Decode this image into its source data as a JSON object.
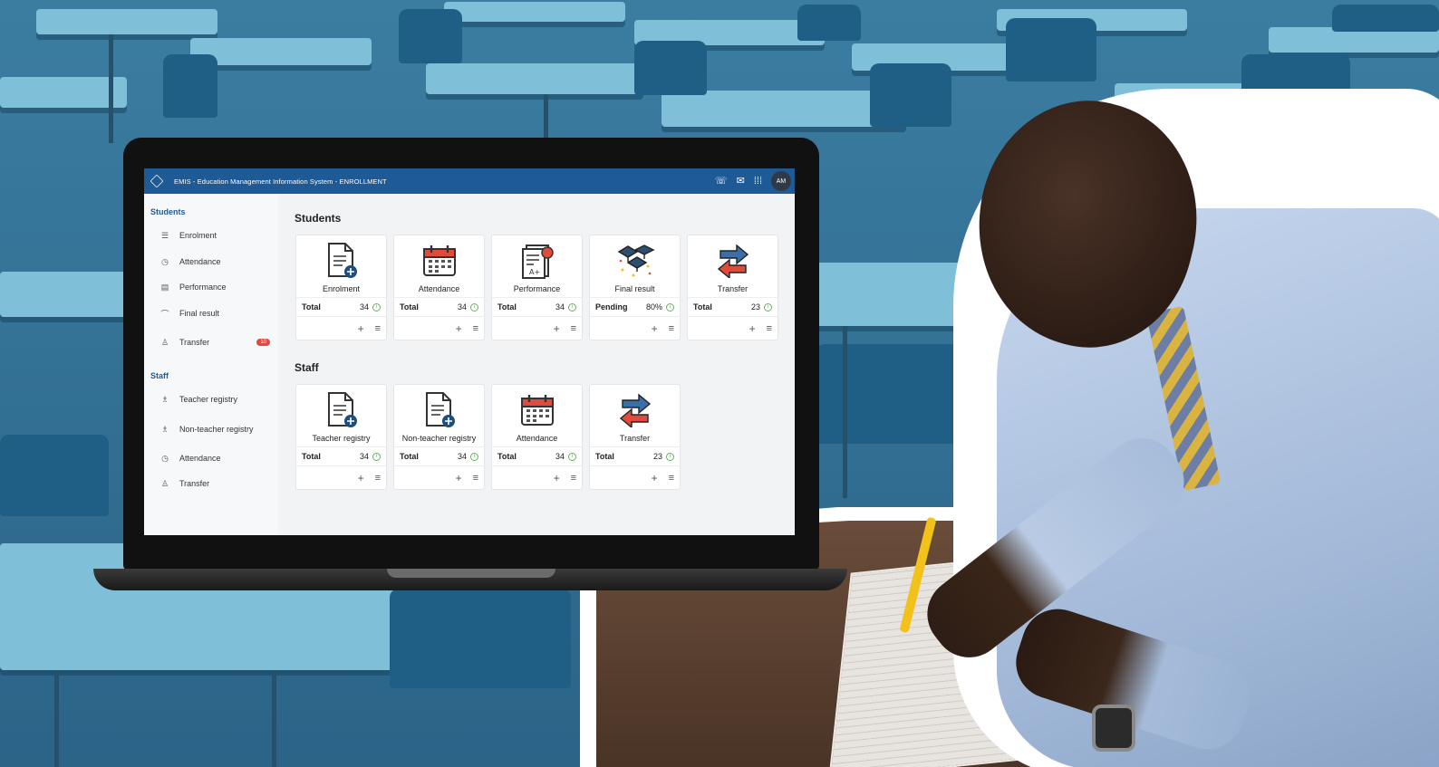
{
  "app": {
    "title": "EMIS - Education Management Information System - ENROLLMENT",
    "user_initials": "AM"
  },
  "topbar_icons": [
    "phone-icon",
    "mail-icon",
    "apps-grid-icon"
  ],
  "sidebar": {
    "students_heading": "Students",
    "students_items": [
      {
        "label": "Enrolment",
        "icon": "list-icon"
      },
      {
        "label": "Attendance",
        "icon": "clock-icon"
      },
      {
        "label": "Performance",
        "icon": "document-icon"
      },
      {
        "label": "Final result",
        "icon": "graduation-cap-icon"
      },
      {
        "label": "Transfer",
        "icon": "person-transfer-icon",
        "badge": "10"
      }
    ],
    "staff_heading": "Staff",
    "staff_items": [
      {
        "label": "Teacher registry",
        "icon": "people-icon"
      },
      {
        "label": "Non-teacher registry",
        "icon": "people-icon"
      },
      {
        "label": "Attendance",
        "icon": "clock-icon"
      },
      {
        "label": "Transfer",
        "icon": "person-transfer-icon"
      }
    ]
  },
  "students": {
    "title": "Students",
    "cards": [
      {
        "name": "Enrolment",
        "stat_label": "Total",
        "stat_value": "34",
        "icon": "document-add-icon"
      },
      {
        "name": "Attendance",
        "stat_label": "Total",
        "stat_value": "34",
        "icon": "calendar-icon"
      },
      {
        "name": "Performance",
        "stat_label": "Total",
        "stat_value": "34",
        "icon": "report-card-icon"
      },
      {
        "name": "Final result",
        "stat_label": "Pending",
        "stat_value": "80%",
        "icon": "graduation-caps-icon"
      },
      {
        "name": "Transfer",
        "stat_label": "Total",
        "stat_value": "23",
        "icon": "transfer-arrows-icon"
      }
    ]
  },
  "staff": {
    "title": "Staff",
    "cards": [
      {
        "name": "Teacher registry",
        "stat_label": "Total",
        "stat_value": "34",
        "icon": "document-add-icon"
      },
      {
        "name": "Non-teacher registry",
        "stat_label": "Total",
        "stat_value": "34",
        "icon": "document-add-icon"
      },
      {
        "name": "Attendance",
        "stat_label": "Total",
        "stat_value": "34",
        "icon": "calendar-icon"
      },
      {
        "name": "Transfer",
        "stat_label": "Total",
        "stat_value": "23",
        "icon": "transfer-arrows-icon"
      }
    ]
  },
  "card_actions": {
    "add_symbol": "+",
    "menu_symbol": "≡"
  },
  "colors": {
    "topbar": "#1e5a95",
    "accent_blue": "#1e5a95",
    "badge_red": "#e84545",
    "info_green": "#5cb85c",
    "background_teal": "#3a7da3"
  }
}
